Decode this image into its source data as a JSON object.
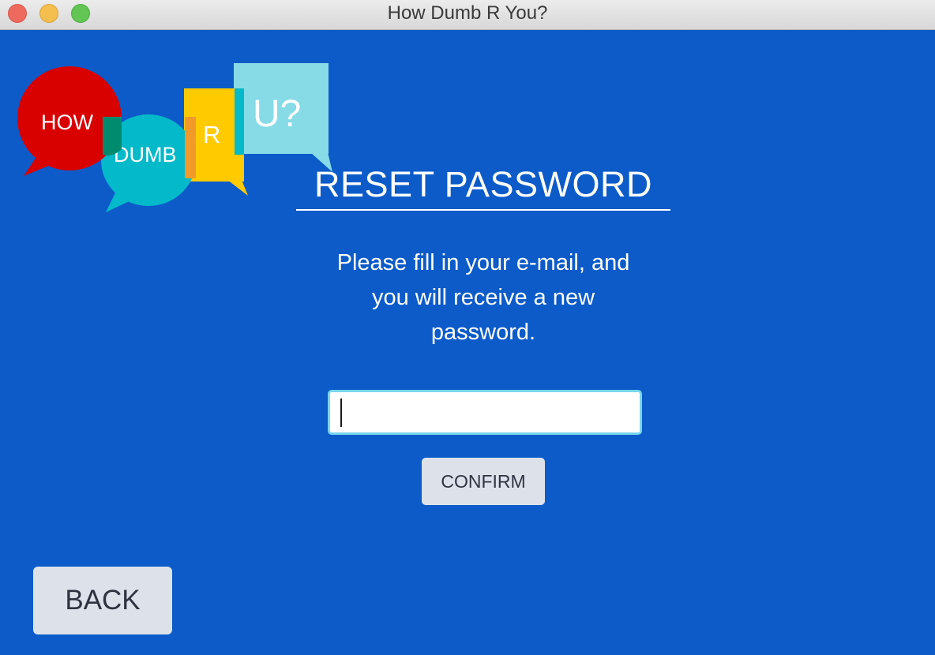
{
  "window": {
    "title": "How Dumb R You?"
  },
  "logo": {
    "word1": "HOW",
    "word2": "DUMB",
    "word3": "R",
    "word4": "U?",
    "colors": {
      "red": "#d90000",
      "teal": "#04b9c9",
      "yellow": "#ffcb00",
      "light_blue": "#86dbe7"
    }
  },
  "reset": {
    "heading": "RESET PASSWORD",
    "instructions": "Please fill in your e-mail, and\nyou will receive a new\npassword.",
    "email_value": "",
    "email_placeholder": "",
    "confirm_label": "CONFIRM"
  },
  "navigation": {
    "back_label": "BACK"
  },
  "theme": {
    "background": "#0c5bc9",
    "button_background": "#dde2ea",
    "input_focus_border": "#79d6ee"
  }
}
